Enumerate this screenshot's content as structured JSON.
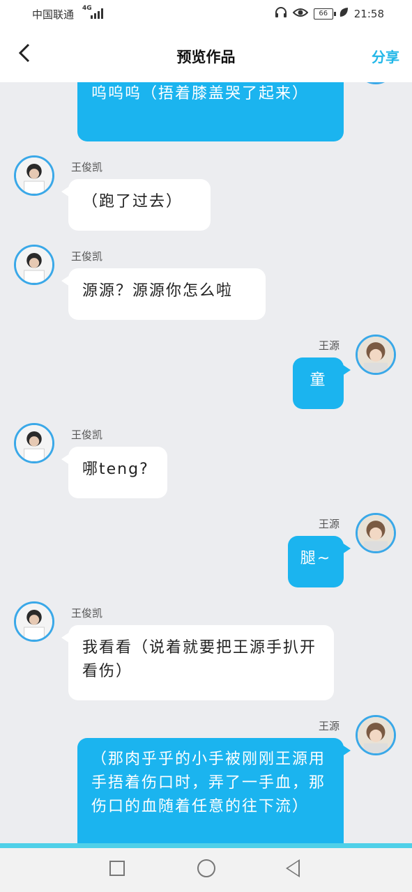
{
  "status": {
    "carrier": "中国联通",
    "network": "4G",
    "battery": "66",
    "time": "21:58"
  },
  "header": {
    "back": "‹",
    "title": "预览作品",
    "share": "分享"
  },
  "colors": {
    "accent": "#1bb4ef",
    "background": "#ecedf0",
    "bubble_white": "#ffffff",
    "avatar_border": "#3aa8e8"
  },
  "messages": [
    {
      "side": "right",
      "name": "",
      "text": "呜呜呜（捂着膝盖哭了起来）"
    },
    {
      "side": "left",
      "name": "王俊凯",
      "text": "（跑了过去）"
    },
    {
      "side": "left",
      "name": "王俊凯",
      "text": "源源？源源你怎么啦"
    },
    {
      "side": "right",
      "name": "王源",
      "text": "童"
    },
    {
      "side": "left",
      "name": "王俊凯",
      "text": "哪teng?"
    },
    {
      "side": "right",
      "name": "王源",
      "text": "腿~"
    },
    {
      "side": "left",
      "name": "王俊凯",
      "text": "我看看（说着就要把王源手扒开看伤）"
    },
    {
      "side": "right",
      "name": "王源",
      "text": "（那肉乎乎的小手被刚刚王源用手捂着伤口时，弄了一手血，那伤口的血随着任意的往下流）"
    }
  ],
  "icons": {
    "headset": "headset-icon",
    "eye": "eye-icon",
    "leaf": "leaf-icon",
    "back": "back-arrow-icon"
  }
}
